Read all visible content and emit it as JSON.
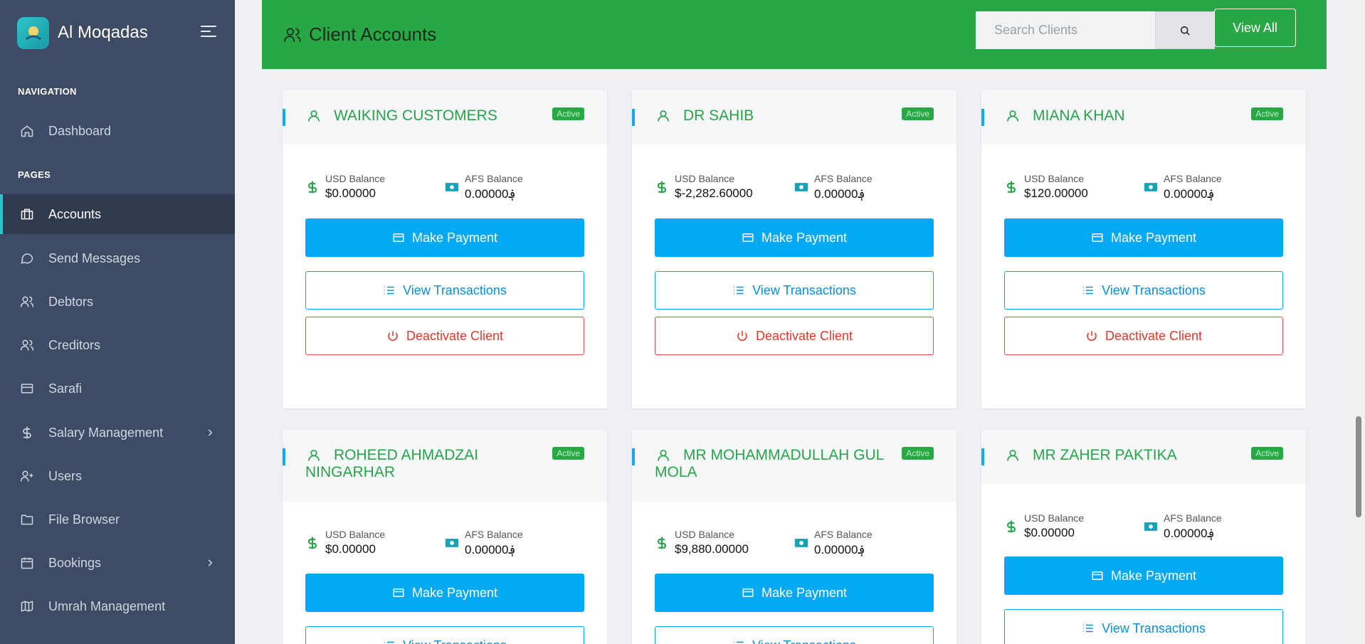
{
  "app": {
    "name": "Al Moqadas"
  },
  "sidebar": {
    "sections": {
      "navigation": "NAVIGATION",
      "pages": "PAGES"
    },
    "items": [
      {
        "label": "Dashboard",
        "icon": "home-icon"
      },
      {
        "label": "Accounts",
        "icon": "briefcase-icon",
        "active": true
      },
      {
        "label": "Send Messages",
        "icon": "message-icon"
      },
      {
        "label": "Debtors",
        "icon": "users-icon"
      },
      {
        "label": "Creditors",
        "icon": "users-icon"
      },
      {
        "label": "Sarafi",
        "icon": "card-icon"
      },
      {
        "label": "Salary Management",
        "icon": "dollar-icon",
        "expandable": true
      },
      {
        "label": "Users",
        "icon": "user-plus-icon"
      },
      {
        "label": "File Browser",
        "icon": "folder-icon"
      },
      {
        "label": "Bookings",
        "icon": "calendar-icon",
        "expandable": true
      },
      {
        "label": "Umrah Management",
        "icon": "map-icon"
      }
    ]
  },
  "header": {
    "title": "Client Accounts",
    "search_placeholder": "Search Clients",
    "view_all_label": "View All"
  },
  "labels": {
    "usd_balance": "USD Balance",
    "afs_balance": "AFS Balance",
    "make_payment": "Make Payment",
    "view_transactions": "View Transactions",
    "deactivate_client": "Deactivate Client",
    "status_active": "Active"
  },
  "clients": [
    {
      "name": "WAIKING CUSTOMERS",
      "usd": "$0.00000",
      "afs": "0.00000؋"
    },
    {
      "name": "DR SAHIB",
      "usd": "$-2,282.60000",
      "afs": "0.00000؋"
    },
    {
      "name": "MIANA KHAN",
      "usd": "$120.00000",
      "afs": "0.00000؋"
    },
    {
      "name_line1": "ROHEED AHMADZAI",
      "name_line2": "NINGARHAR",
      "usd": "$0.00000",
      "afs": "0.00000؋"
    },
    {
      "name_line1": "MR MOHAMMADULLAH GUL",
      "name_line2": "MOLA",
      "usd": "$9,880.00000",
      "afs": "0.00000؋"
    },
    {
      "name": "MR ZAHER PAKTIKA",
      "usd": "$0.00000",
      "afs": "0.00000؋"
    }
  ],
  "colors": {
    "sidebar_bg": "#3e4b64",
    "header_green": "#28a745",
    "primary_blue": "#03a9f4",
    "danger_red": "#e74c3c",
    "client_name_green": "#2aa24a"
  }
}
